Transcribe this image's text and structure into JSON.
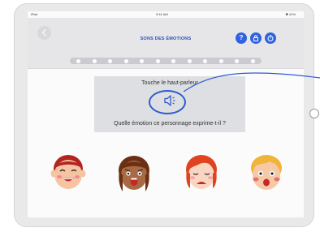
{
  "device": {
    "carrier": "iPad",
    "time": "9:41 AM",
    "battery": "✱ 41%"
  },
  "header": {
    "title": "SONS DES ÉMOTIONS",
    "help_label": "?",
    "progress_total": 12,
    "progress_current": 0
  },
  "prompt": {
    "instruction": "Touche le haut-parleur",
    "question": "Quelle émotion ce personnage exprime-t-il ?"
  },
  "answers": [
    {
      "name": "happy-face",
      "hair": "#b3241f",
      "skin": "#f6c4a3"
    },
    {
      "name": "scared-face",
      "hair": "#6b2f14",
      "skin": "#a86a44"
    },
    {
      "name": "sad-face",
      "hair": "#e0431f",
      "skin": "#f8d6c2"
    },
    {
      "name": "surprised-face",
      "hair": "#f0b43a",
      "skin": "#f6c9a6"
    }
  ],
  "colors": {
    "accent": "#2f63e0",
    "title": "#2a4fb8"
  }
}
